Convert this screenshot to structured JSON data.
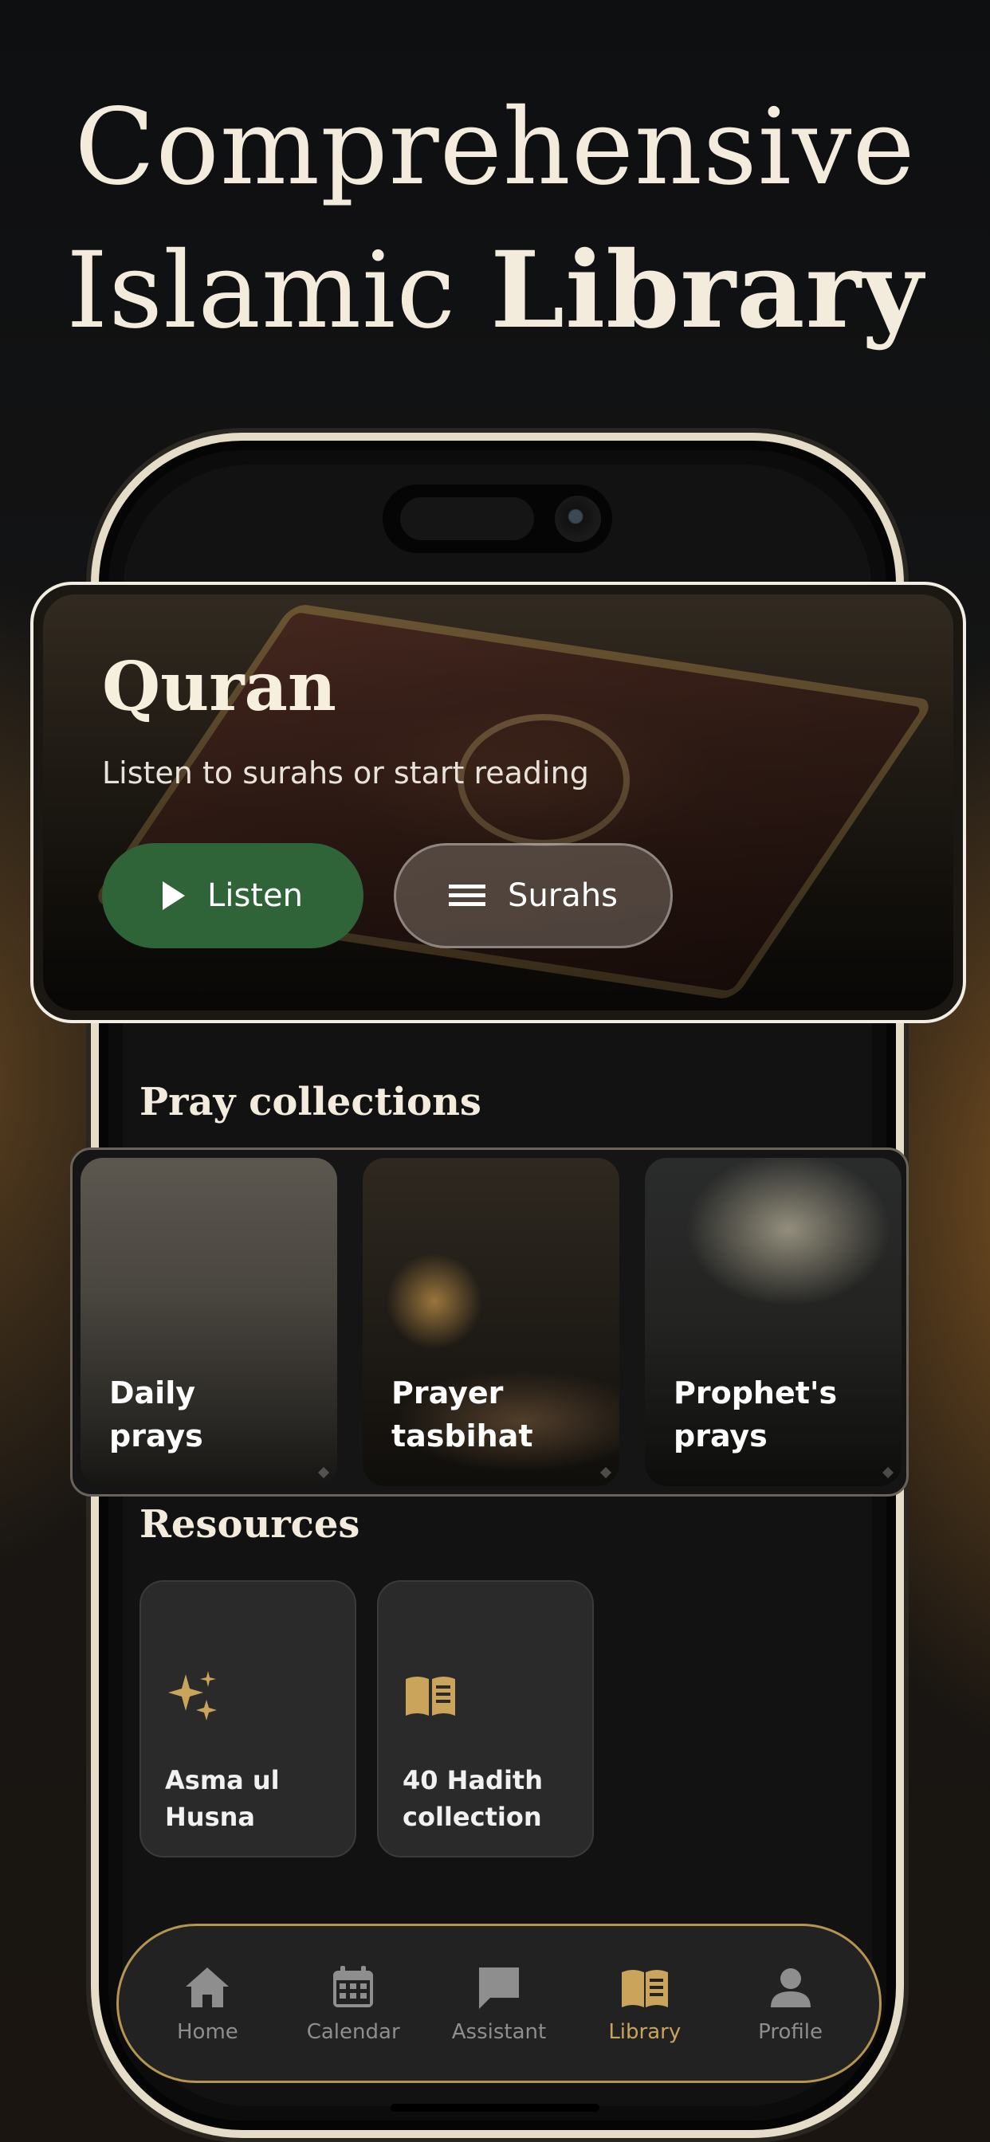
{
  "headline": {
    "line1": "Comprehensive",
    "line2_regular": "Islamic ",
    "line2_bold": "Library"
  },
  "quran": {
    "title": "Quran",
    "subtitle": "Listen to surahs or start reading",
    "listen_label": "Listen",
    "surahs_label": "Surahs"
  },
  "collections": {
    "title": "Pray collections",
    "items": [
      {
        "line1": "Daily",
        "line2": "prays"
      },
      {
        "line1": "Prayer",
        "line2": "tasbihat"
      },
      {
        "line1": "Prophet's",
        "line2": "prays"
      }
    ]
  },
  "resources": {
    "title": "Resources",
    "items": [
      {
        "line1": "Asma ul",
        "line2": "Husna",
        "icon": "sparkles-icon"
      },
      {
        "line1": "40 Hadith",
        "line2": "collection",
        "icon": "open-book-icon"
      }
    ]
  },
  "tabbar": {
    "items": [
      {
        "label": "Home",
        "icon": "home-icon",
        "active": false
      },
      {
        "label": "Calendar",
        "icon": "calendar-icon",
        "active": false
      },
      {
        "label": "Assistant",
        "icon": "chat-icon",
        "active": false
      },
      {
        "label": "Library",
        "icon": "book-icon",
        "active": true
      },
      {
        "label": "Profile",
        "icon": "person-icon",
        "active": false
      }
    ]
  },
  "colors": {
    "accent_gold": "#c9a45a",
    "listen_green": "#2f6338",
    "text_cream": "#f3ecdc"
  }
}
